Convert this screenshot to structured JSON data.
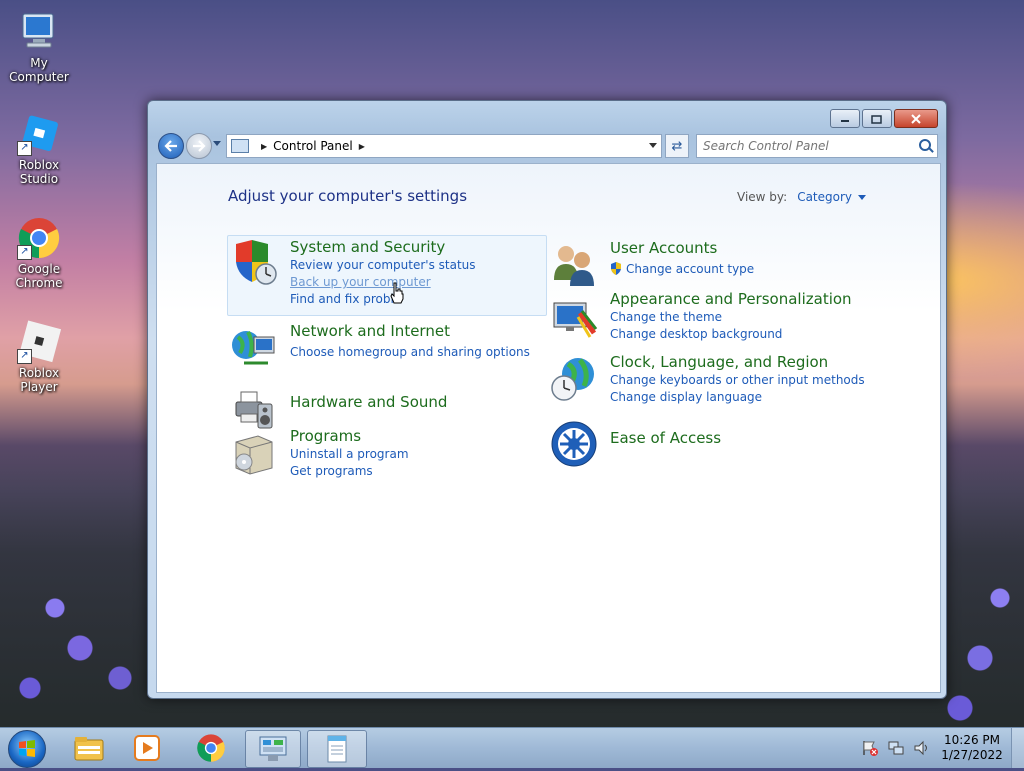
{
  "desktop": {
    "icons": [
      {
        "label": "My Computer"
      },
      {
        "label": "Roblox Studio"
      },
      {
        "label": "Google Chrome"
      },
      {
        "label": "Roblox Player"
      }
    ]
  },
  "window": {
    "address": {
      "crumb": "Control Panel"
    },
    "search": {
      "placeholder": "Search Control Panel"
    },
    "heading": "Adjust your computer's settings",
    "view_by": {
      "label": "View by:",
      "value": "Category"
    },
    "categories": [
      {
        "title": "System and Security",
        "links": [
          "Review your computer's status",
          "Back up your computer",
          "Find and fix proble"
        ]
      },
      {
        "title": "Network and Internet",
        "links": [
          "Choose homegroup and sharing options"
        ]
      },
      {
        "title": "Hardware and Sound",
        "links": []
      },
      {
        "title": "Programs",
        "links": [
          "Uninstall a program",
          "Get programs"
        ]
      },
      {
        "title": "User Accounts",
        "links": [
          "Change account type"
        ]
      },
      {
        "title": "Appearance and Personalization",
        "links": [
          "Change the theme",
          "Change desktop background"
        ]
      },
      {
        "title": "Clock, Language, and Region",
        "links": [
          "Change keyboards or other input methods",
          "Change display language"
        ]
      },
      {
        "title": "Ease of Access",
        "links": []
      }
    ]
  },
  "taskbar": {
    "clock": {
      "time": "10:26 PM",
      "date": "1/27/2022"
    }
  }
}
